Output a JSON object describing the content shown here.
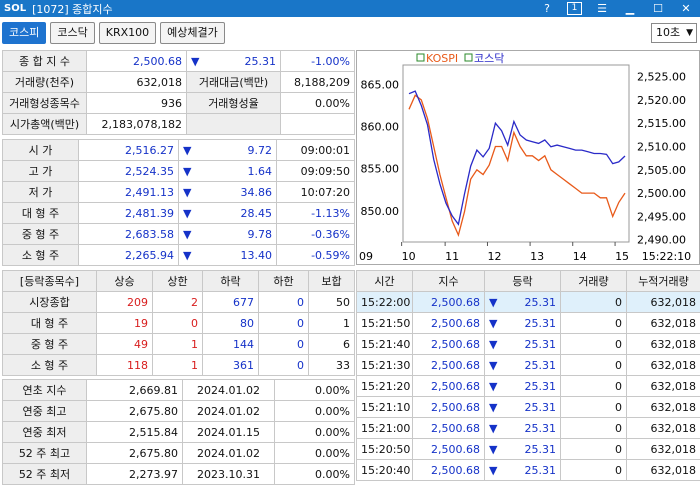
{
  "window": {
    "logo": "SOL",
    "title": "[1072] 종합지수",
    "help": "?",
    "btn1": "1",
    "menu": "☰",
    "minimize": "▁",
    "maximize": "☐",
    "close": "✕"
  },
  "tabs": [
    "코스피",
    "코스닥",
    "KRX100",
    "예상체결가"
  ],
  "interval": "10초",
  "summary": {
    "rows": [
      [
        "종 합 지 수",
        "2,500.68",
        "▼",
        "25.31",
        "-1.00%"
      ],
      [
        "거래량(천주)",
        "632,018",
        "거래대금(백만)",
        "8,188,209"
      ],
      [
        "거래형성종목수",
        "936",
        "거래형성율",
        "0.00%"
      ],
      [
        "시가총액(백만)",
        "2,183,078,182"
      ]
    ]
  },
  "ohlc": {
    "rows": [
      [
        "시 가",
        "2,516.27",
        "▼",
        "9.72",
        "09:00:01"
      ],
      [
        "고 가",
        "2,524.35",
        "▼",
        "1.64",
        "09:09:50"
      ],
      [
        "저 가",
        "2,491.13",
        "▼",
        "34.86",
        "10:07:20"
      ],
      [
        "대 형 주",
        "2,481.39",
        "▼",
        "28.45",
        "-1.13%"
      ],
      [
        "중 형 주",
        "2,683.58",
        "▼",
        "9.78",
        "-0.36%"
      ],
      [
        "소 형 주",
        "2,265.94",
        "▼",
        "13.40",
        "-0.59%"
      ]
    ]
  },
  "breadth": {
    "headers": [
      "[등락종목수]",
      "상승",
      "상한",
      "하락",
      "하한",
      "보합"
    ],
    "rows": [
      [
        "시장종합",
        "209",
        "2",
        "677",
        "0",
        "50"
      ],
      [
        "대 형 주",
        "19",
        "0",
        "80",
        "0",
        "1"
      ],
      [
        "중 형 주",
        "49",
        "1",
        "144",
        "0",
        "6"
      ],
      [
        "소 형 주",
        "118",
        "1",
        "361",
        "0",
        "33"
      ]
    ]
  },
  "yearly": {
    "rows": [
      [
        "연초 지수",
        "2,669.81",
        "2024.01.02",
        "0.00%"
      ],
      [
        "연중 최고",
        "2,675.80",
        "2024.01.02",
        "0.00%"
      ],
      [
        "연중 최저",
        "2,515.84",
        "2024.01.15",
        "0.00%"
      ],
      [
        "52 주 최고",
        "2,675.80",
        "2024.01.02",
        "0.00%"
      ],
      [
        "52 주 최저",
        "2,273.97",
        "2023.10.31",
        "0.00%"
      ]
    ]
  },
  "ticks": {
    "headers": [
      "시간",
      "지수",
      "등락",
      "거래량",
      "누적거래량"
    ],
    "rows": [
      [
        "15:22:00",
        "2,500.68",
        "▼",
        "25.31",
        "0",
        "632,018"
      ],
      [
        "15:21:50",
        "2,500.68",
        "▼",
        "25.31",
        "0",
        "632,018"
      ],
      [
        "15:21:40",
        "2,500.68",
        "▼",
        "25.31",
        "0",
        "632,018"
      ],
      [
        "15:21:30",
        "2,500.68",
        "▼",
        "25.31",
        "0",
        "632,018"
      ],
      [
        "15:21:20",
        "2,500.68",
        "▼",
        "25.31",
        "0",
        "632,018"
      ],
      [
        "15:21:10",
        "2,500.68",
        "▼",
        "25.31",
        "0",
        "632,018"
      ],
      [
        "15:21:00",
        "2,500.68",
        "▼",
        "25.31",
        "0",
        "632,018"
      ],
      [
        "15:20:50",
        "2,500.68",
        "▼",
        "25.31",
        "0",
        "632,018"
      ],
      [
        "15:20:40",
        "2,500.68",
        "▼",
        "25.31",
        "0",
        "632,018"
      ]
    ]
  },
  "chart_data": {
    "type": "line",
    "legend": [
      "KOSPI",
      "코스닥"
    ],
    "left_axis": [
      "865.00",
      "860.00",
      "855.00",
      "850.00"
    ],
    "right_axis": [
      "2,525.00",
      "2,520.00",
      "2,515.00",
      "2,510.00",
      "2,505.00",
      "2,500.00",
      "2,495.00",
      "2,490.00"
    ],
    "x_ticks": [
      "09",
      "10",
      "11",
      "12",
      "13",
      "14",
      "15",
      "15:22:10"
    ],
    "ylim_left": [
      846.3,
      867.3
    ],
    "ylim_right": [
      2489.5,
      2527.5
    ],
    "series": [
      {
        "name": "KOSPI",
        "color": "#e85a1a",
        "axis": "right",
        "values": [
          2518,
          2521,
          2520,
          2516,
          2510,
          2504,
          2499,
          2494,
          2491,
          2496,
          2503,
          2505,
          2504,
          2506,
          2510,
          2510,
          2507,
          2513,
          2510,
          2508,
          2508,
          2507,
          2508,
          2505,
          2504,
          2503,
          2502,
          2501,
          2500,
          2500,
          2500,
          2499,
          2499,
          2495,
          2498,
          2500
        ]
      },
      {
        "name": "코스닥",
        "color": "#2a2ac8",
        "axis": "left",
        "values": [
          863.9,
          864.2,
          862.5,
          860.2,
          856.1,
          853.2,
          850.9,
          849.4,
          848.4,
          852.0,
          855.3,
          857.2,
          856.4,
          857.4,
          860.4,
          859.5,
          857.8,
          860.6,
          859.0,
          858.4,
          858.2,
          858.0,
          858.4,
          857.6,
          857.8,
          857.6,
          857.4,
          857.2,
          857.2,
          857.0,
          856.8,
          856.8,
          856.7,
          855.6,
          855.8,
          856.5
        ]
      }
    ]
  }
}
